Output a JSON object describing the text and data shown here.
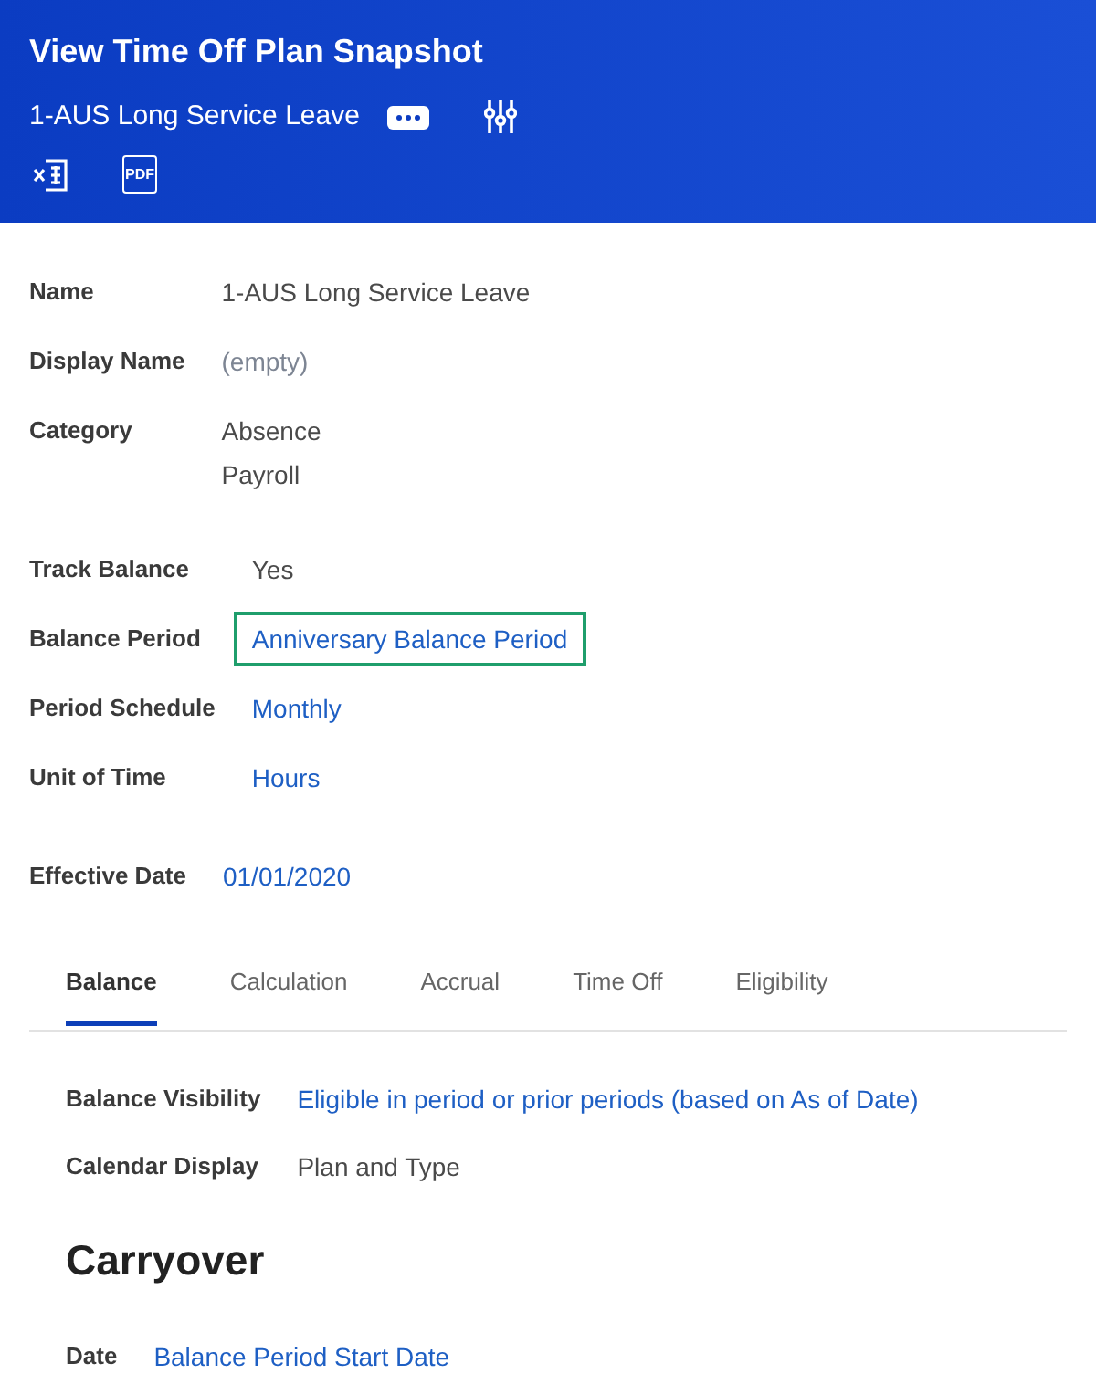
{
  "header": {
    "title": "View Time Off Plan Snapshot",
    "subtitle": "1-AUS Long Service Leave",
    "export_buttons": [
      {
        "kind": "excel"
      },
      {
        "kind": "pdf",
        "label": "PDF"
      }
    ]
  },
  "field_groups": [
    {
      "fields": [
        {
          "label": "Name",
          "highlighted": false,
          "values": [
            {
              "text": "1-AUS Long Service Leave",
              "kind": "text"
            }
          ]
        },
        {
          "label": "Display Name",
          "highlighted": false,
          "values": [
            {
              "text": "(empty)",
              "kind": "empty"
            }
          ]
        },
        {
          "label": "Category",
          "highlighted": false,
          "values": [
            {
              "text": "Absence",
              "kind": "text"
            },
            {
              "text": "Payroll",
              "kind": "text"
            }
          ]
        }
      ]
    },
    {
      "fields": [
        {
          "label": "Track Balance",
          "highlighted": false,
          "values": [
            {
              "text": "Yes",
              "kind": "text"
            }
          ]
        },
        {
          "label": "Balance Period",
          "highlighted": true,
          "values": [
            {
              "text": "Anniversary Balance Period",
              "kind": "link"
            }
          ]
        },
        {
          "label": "Period Schedule",
          "highlighted": false,
          "values": [
            {
              "text": "Monthly",
              "kind": "link"
            }
          ]
        },
        {
          "label": "Unit of Time",
          "highlighted": false,
          "values": [
            {
              "text": "Hours",
              "kind": "link"
            }
          ]
        }
      ]
    },
    {
      "fields": [
        {
          "label": "Effective Date",
          "highlighted": false,
          "values": [
            {
              "text": "01/01/2020",
              "kind": "link"
            }
          ]
        }
      ]
    }
  ],
  "tabs": [
    {
      "label": "Balance",
      "selected": true
    },
    {
      "label": "Calculation",
      "selected": false
    },
    {
      "label": "Accrual",
      "selected": false
    },
    {
      "label": "Time Off",
      "selected": false
    },
    {
      "label": "Eligibility",
      "selected": false
    }
  ],
  "tab_fields": [
    {
      "label": "Balance Visibility",
      "highlighted": false,
      "values": [
        {
          "text": "Eligible in period or prior periods (based on As of Date)",
          "kind": "link"
        }
      ]
    },
    {
      "label": "Calendar Display",
      "highlighted": false,
      "values": [
        {
          "text": "Plan and Type",
          "kind": "text"
        }
      ]
    }
  ],
  "carryover": {
    "heading": "Carryover",
    "fields": [
      {
        "label": "Date",
        "highlighted": false,
        "values": [
          {
            "text": "Balance Period Start Date",
            "kind": "link"
          }
        ]
      }
    ]
  }
}
